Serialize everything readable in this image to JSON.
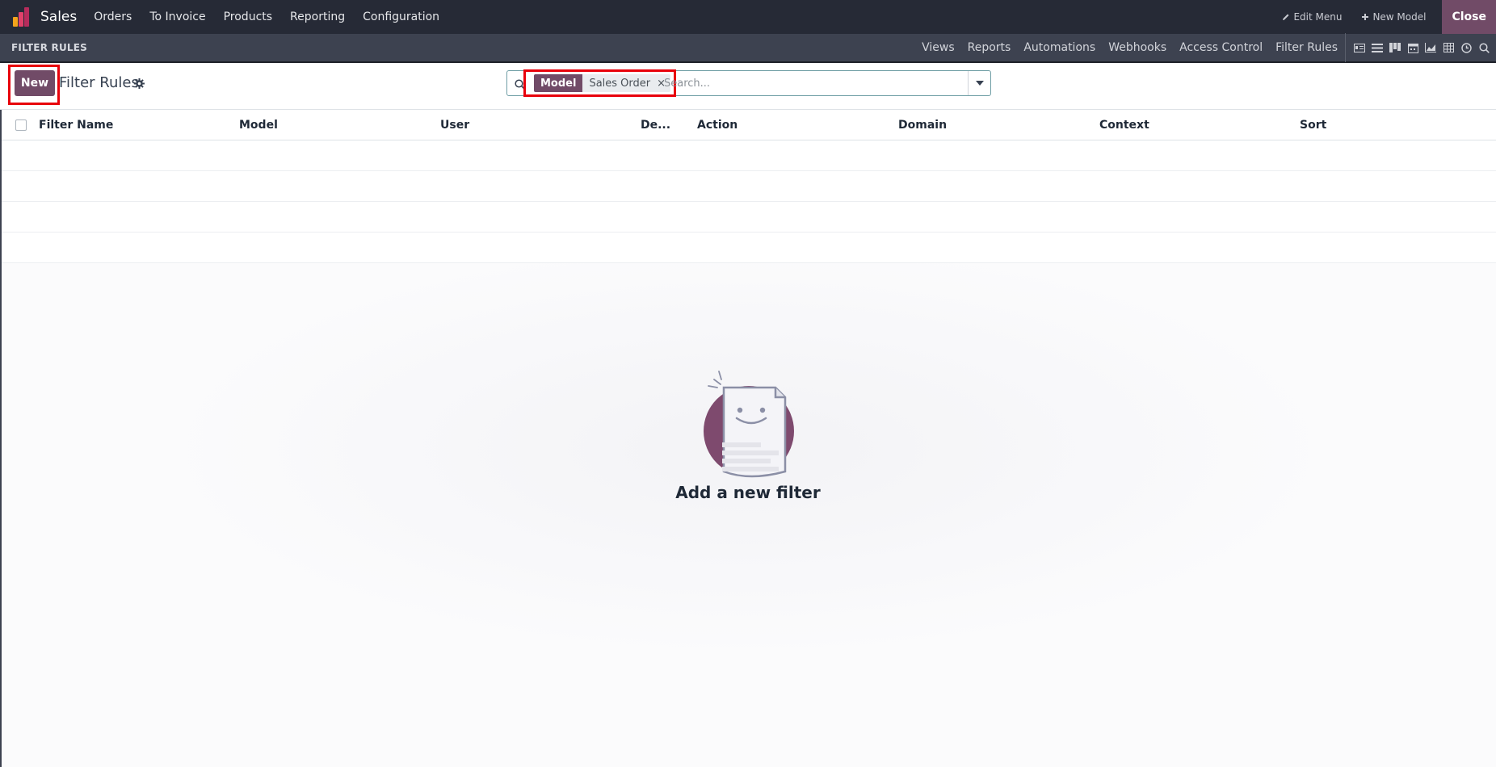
{
  "topbar": {
    "app_name": "Sales",
    "menu": [
      "Orders",
      "To Invoice",
      "Products",
      "Reporting",
      "Configuration"
    ],
    "edit_menu": "Edit Menu",
    "new_model": "New Model",
    "close": "Close"
  },
  "studio": {
    "title": "FILTER RULES",
    "links": [
      "Views",
      "Reports",
      "Automations",
      "Webhooks",
      "Access Control",
      "Filter Rules"
    ],
    "view_icons": [
      "form-view-icon",
      "list-view-icon",
      "kanban-view-icon",
      "calendar-view-icon",
      "graph-view-icon",
      "pivot-view-icon",
      "activity-view-icon",
      "search-view-icon"
    ]
  },
  "control": {
    "new_button": "New",
    "title": "Filter Rules"
  },
  "search": {
    "facet_label": "Model",
    "facet_value": "Sales Order",
    "facet_remove": "×",
    "placeholder": "Search..."
  },
  "table": {
    "columns": [
      "Filter Name",
      "Model",
      "User",
      "De...",
      "Action",
      "Domain",
      "Context",
      "Sort"
    ]
  },
  "empty": {
    "title": "Add a new filter"
  },
  "colors": {
    "primary": "#714b67",
    "navbar": "#262a36",
    "studio_bar": "#3d4250",
    "highlight": "#e8000b"
  }
}
